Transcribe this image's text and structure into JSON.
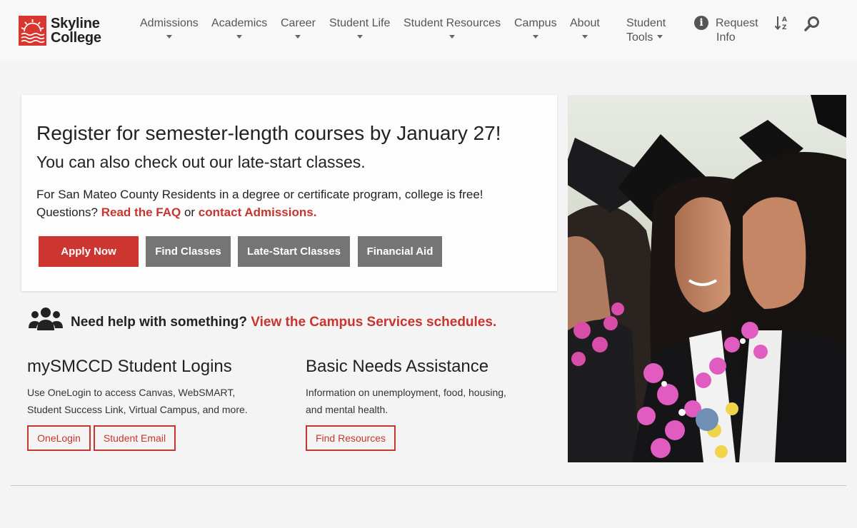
{
  "header": {
    "logo": {
      "line1": "Skyline",
      "line2": "College"
    },
    "nav": [
      {
        "label": "Admissions"
      },
      {
        "label": "Academics"
      },
      {
        "label": "Career"
      },
      {
        "label": "Student Life"
      },
      {
        "label": "Student Resources"
      },
      {
        "label": "Campus"
      },
      {
        "label": "About"
      }
    ],
    "student_tools": {
      "line1": "Student",
      "line2": "Tools"
    },
    "request_info": {
      "line1": "Request",
      "line2": "Info"
    },
    "icons": {
      "sort": "sort-alpha-icon",
      "search": "search-icon",
      "info": "info-icon"
    }
  },
  "hero": {
    "headline": "Register for semester-length courses by January 27!",
    "subheadline": "You can also check out our late-start classes.",
    "body_line1": "For San Mateo County Residents in a degree or certificate program, college is free!",
    "body_prefix": "Questions?",
    "faq_link": "Read the FAQ",
    "or_text": "or",
    "admissions_link": "contact Admissions.",
    "buttons": {
      "apply": "Apply Now",
      "find_classes": "Find Classes",
      "late_start": "Late-Start Classes",
      "financial_aid": "Financial Aid"
    }
  },
  "help": {
    "text": "Need help with something?",
    "link": "View the Campus Services schedules."
  },
  "logins": {
    "title": "mySMCCD Student Logins",
    "desc_line1": "Use OneLogin to access Canvas, WebSMART,",
    "desc_line2": "Student Success Link, Virtual Campus, and more.",
    "btn_onelogin": "OneLogin",
    "btn_email": "Student Email"
  },
  "basic_needs": {
    "title": "Basic Needs Assistance",
    "desc_line1": "Information on unemployment, food, housing,",
    "desc_line2": "and mental health.",
    "btn": "Find Resources"
  },
  "colors": {
    "brand_red": "#cc3530",
    "link_red": "#c7352e",
    "button_grey": "#757575",
    "page_bg": "#f4f4f4"
  }
}
